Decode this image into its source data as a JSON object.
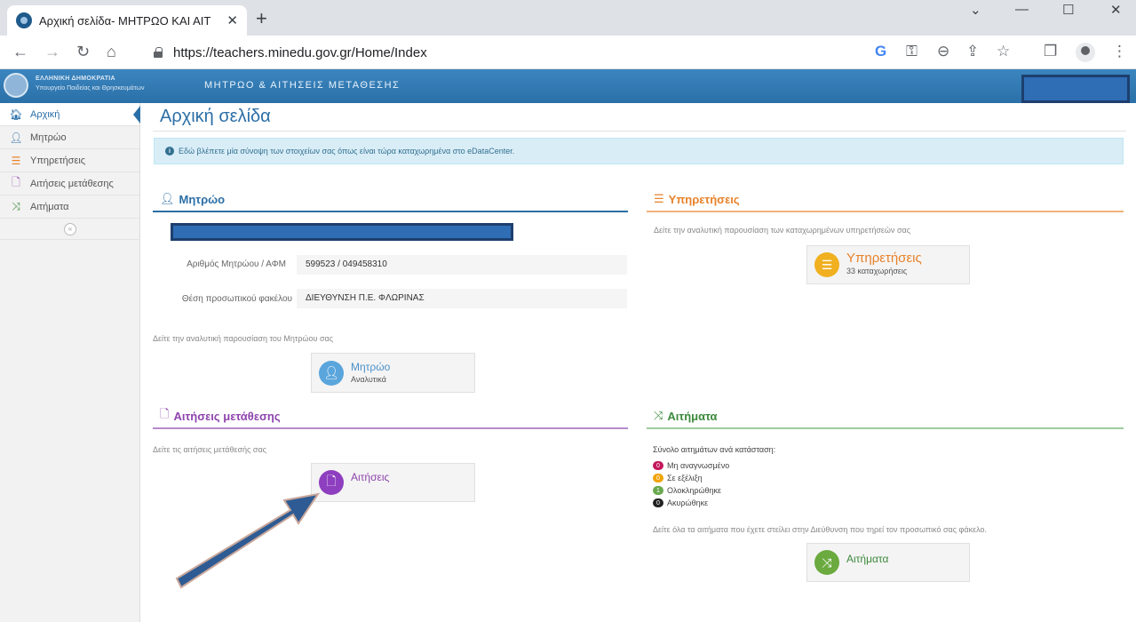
{
  "browser": {
    "tab_title": "Αρχική σελίδα- ΜΗΤΡΩΟ ΚΑΙ ΑΙΤ",
    "tab_close": "✕",
    "new_tab": "+",
    "url": "https://teachers.minedu.gov.gr/Home/Index"
  },
  "header": {
    "logo_line1": "ΕΛΛΗΝΙΚΗ ΔΗΜΟΚΡΑΤΙΑ",
    "logo_line2": "Υπουργείο Παιδείας και Θρησκευμάτων",
    "app_title": "ΜΗΤΡΩΟ & ΑΙΤΗΣΕΙΣ ΜΕΤΑΘΕΣΗΣ"
  },
  "sidebar": {
    "items": [
      {
        "label": "Αρχική",
        "icon": "home-icon",
        "active": true
      },
      {
        "label": "Μητρώο",
        "icon": "user-icon"
      },
      {
        "label": "Υπηρετήσεις",
        "icon": "list-icon"
      },
      {
        "label": "Αιτήσεις μετάθεσης",
        "icon": "file-icon"
      },
      {
        "label": "Αιτήματα",
        "icon": "shuffle-icon"
      }
    ],
    "collapse_icon": "«"
  },
  "main": {
    "page_title": "Αρχική σελίδα",
    "alert_icon": "i",
    "alert_text": "Εδώ βλέπετε μία σύνοψη των στοιχείων σας όπως είναι τώρα καταχωρημένα στο eDataCenter.",
    "registry": {
      "heading": "Μητρώο",
      "fields": [
        {
          "label": "Αριθμός Μητρώου / ΑΦΜ",
          "value": "599523 / 049458310"
        },
        {
          "label": "Θέση προσωπικού φακέλου",
          "value": "ΔΙΕΥΘΥΝΣΗ Π.Ε. ΦΛΩΡΙΝΑΣ"
        }
      ],
      "hint": "Δείτε την αναλυτική παρουσίαση του Μητρώου σας",
      "tile_main": "Μητρώο",
      "tile_sub": "Αναλυτικά"
    },
    "services": {
      "heading": "Υπηρετήσεις",
      "hint": "Δείτε την αναλυτική παρουσίαση των καταχωρημένων υπηρετήσεών σας",
      "tile_main": "Υπηρετήσεις",
      "tile_sub": "33 καταχωρήσεις"
    },
    "transfers": {
      "heading": "Αιτήσεις μετάθεσης",
      "hint": "Δείτε τις αιτήσεις μετάθεσής σας",
      "tile_main": "Αιτήσεις"
    },
    "requests": {
      "heading": "Αιτήματα",
      "summary": "Σύνολο αιτημάτων ανά κατάσταση:",
      "statuses": [
        {
          "count": "0",
          "label": "Μη αναγνωσμένο",
          "color": "#c2185b"
        },
        {
          "count": "0",
          "label": "Σε εξέλιξη",
          "color": "#f0a30a"
        },
        {
          "count": "1",
          "label": "Ολοκληρώθηκε",
          "color": "#6aa84f"
        },
        {
          "count": "0",
          "label": "Ακυρώθηκε",
          "color": "#222222"
        }
      ],
      "hint": "Δείτε όλα τα αιτήματα που έχετε στείλει στην Διεύθυνση που τηρεί τον προσωπικό σας φάκελο.",
      "tile_main": "Αιτήματα"
    }
  },
  "colors": {
    "header_blue": "#2f75ad",
    "registry": "#2b6ea6",
    "services": "#e8822a",
    "transfers": "#8e44ad",
    "requests": "#3c8a3c"
  }
}
